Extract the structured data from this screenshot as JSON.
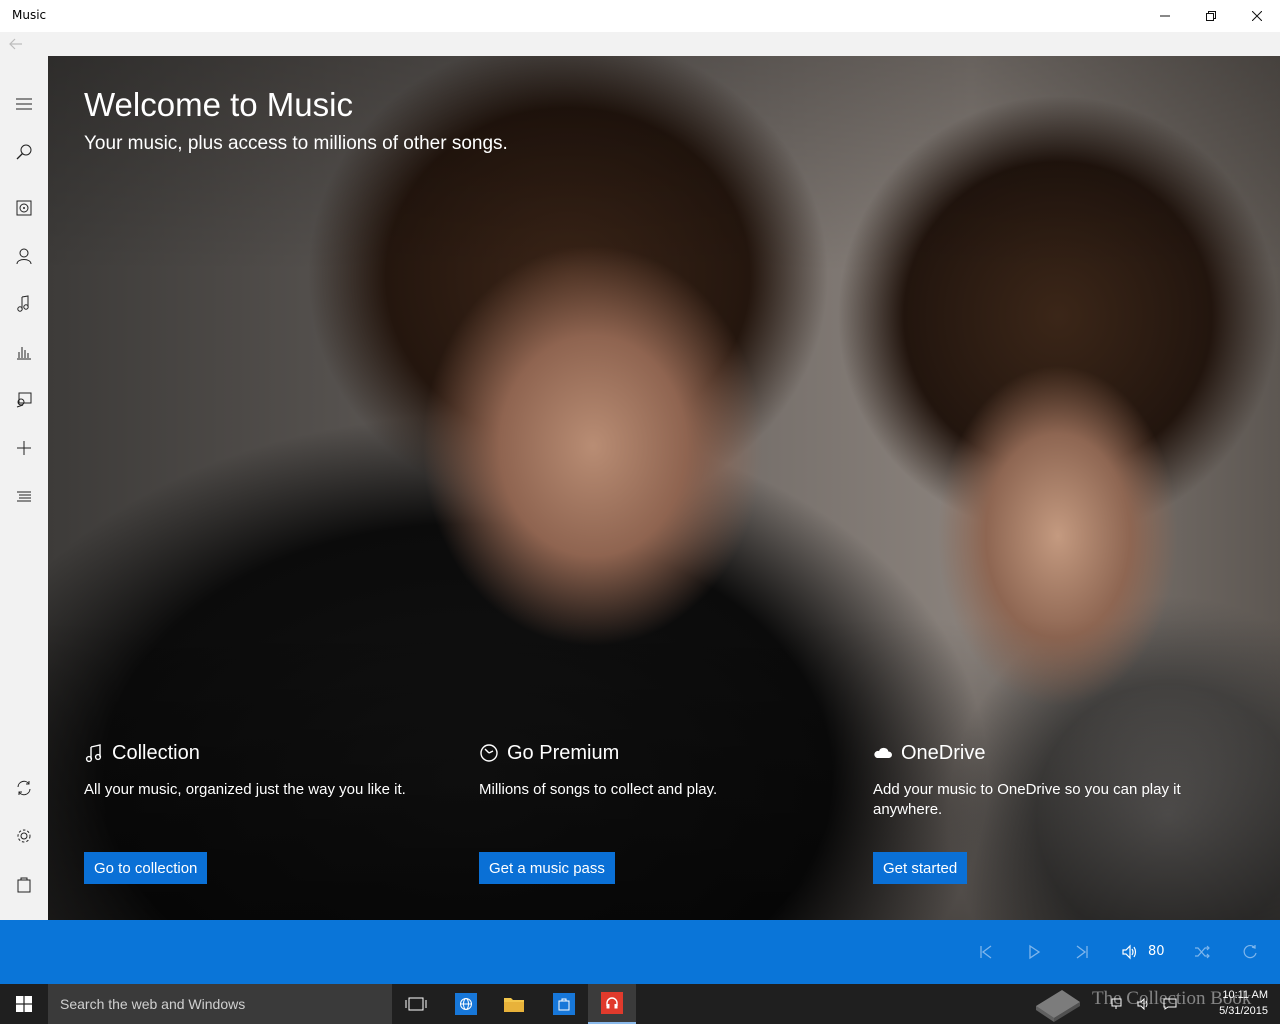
{
  "window": {
    "title": "Music"
  },
  "hero": {
    "title": "Welcome to Music",
    "subtitle": "Your music, plus access to millions of other songs."
  },
  "cards": [
    {
      "icon": "music-note-icon",
      "title": "Collection",
      "description": "All your music, organized just the way you like it.",
      "button": "Go to collection"
    },
    {
      "icon": "premium-icon",
      "title": "Go Premium",
      "description": "Millions of songs to collect and play.",
      "button": "Get a music pass"
    },
    {
      "icon": "cloud-icon",
      "title": "OneDrive",
      "description": "Add your music to OneDrive so you can play it anywhere.",
      "button": "Get started"
    }
  ],
  "rail": {
    "items": [
      "hamburger-icon",
      "search-icon",
      "albums-icon",
      "artists-icon",
      "songs-icon",
      "radio-icon",
      "now-playing-icon",
      "new-playlist-icon",
      "playlists-icon",
      "sync-icon",
      "settings-icon",
      "store-icon"
    ]
  },
  "player": {
    "volume": "80"
  },
  "taskbar": {
    "search_placeholder": "Search the web and Windows",
    "watermark": "The Collection Book",
    "time": "10:11 AM",
    "date": "5/31/2015"
  },
  "colors": {
    "accent": "#0a75d8",
    "button": "#0a70d6",
    "rail": "#f2f2f2",
    "taskbar": "#1f1f1f"
  }
}
